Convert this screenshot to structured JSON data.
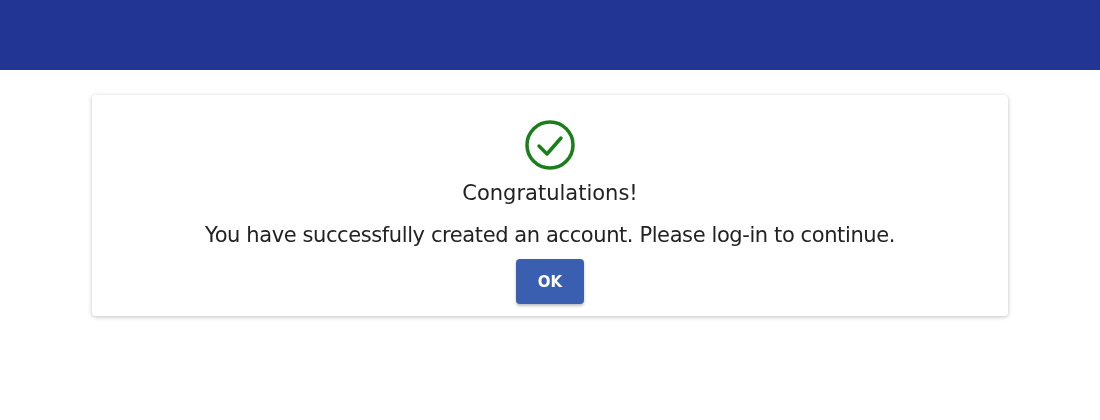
{
  "dialog": {
    "title": "Congratulations!",
    "message": "You have successfully created an account. Please log-in to continue.",
    "buttons": [
      "OK"
    ]
  }
}
